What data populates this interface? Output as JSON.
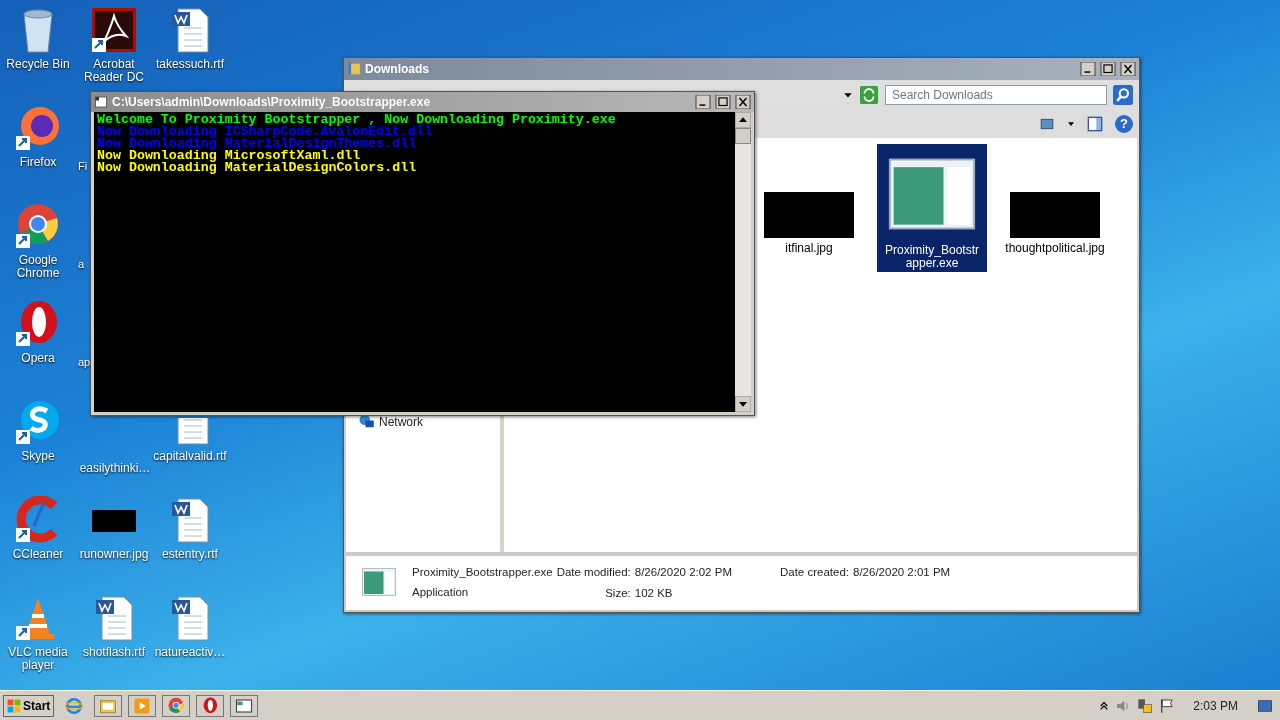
{
  "desktop_columns": [
    [
      {
        "label": "Recycle Bin",
        "kind": "recycle"
      },
      {
        "label": "Firefox",
        "kind": "firefox"
      },
      {
        "label": "Google Chrome",
        "kind": "chrome"
      },
      {
        "label": "Opera",
        "kind": "opera"
      },
      {
        "label": "Skype",
        "kind": "skype"
      },
      {
        "label": "CCleaner",
        "kind": "ccleaner"
      },
      {
        "label": "VLC media player",
        "kind": "vlc"
      }
    ],
    [
      {
        "label": "Acrobat Reader DC",
        "kind": "acrobat"
      },
      {
        "label": "Fi",
        "kind": "covered"
      },
      {
        "label": "a",
        "kind": "covered"
      },
      {
        "label": "ap",
        "kind": "covered"
      },
      {
        "label": "easilythinki…",
        "kind": "covered"
      },
      {
        "label": "runowner.jpg",
        "kind": "image"
      },
      {
        "label": "shotflash.rtf",
        "kind": "word"
      }
    ],
    [
      {
        "label": "takessuch.rtf",
        "kind": "word"
      },
      {
        "kind": "covered"
      },
      {
        "kind": "covered"
      },
      {
        "kind": "covered"
      },
      {
        "label": "capitalvalid.rtf",
        "kind": "word_partial"
      },
      {
        "label": "estentry.rtf",
        "kind": "word"
      },
      {
        "label": "natureactiv…",
        "kind": "word"
      }
    ]
  ],
  "explorer": {
    "title": "Downloads",
    "search": {
      "placeholder": "Search Downloads"
    },
    "nav_items": [
      {
        "label": "Network"
      }
    ],
    "help": "?",
    "files": [
      {
        "kind": "covered"
      },
      {
        "kind": "covered"
      },
      {
        "label": "itfinal.jpg",
        "kind": "image",
        "selected": false
      },
      {
        "label": "Proximity_Bootstrapper.exe",
        "kind": "app",
        "selected": true
      },
      {
        "label": "thoughtpolitical.jpg",
        "kind": "image",
        "selected": false
      }
    ],
    "details": {
      "name": "Proximity_Bootstrapper.exe",
      "type": "Application",
      "fields": [
        {
          "label": "Date modified:",
          "value": "8/26/2020 2:02 PM"
        },
        {
          "label": "Size:",
          "value": "102 KB"
        },
        {
          "label": "Date created:",
          "value": "8/26/2020 2:01 PM"
        }
      ]
    }
  },
  "console": {
    "title": "C:\\Users\\admin\\Downloads\\Proximity_Bootstrapper.exe",
    "lines": [
      {
        "text": "Welcome To Proximity Bootstrapper , Now Downloading Proximity.exe",
        "color": "#00ff00"
      },
      {
        "text": "Now Downloading ICSharpCode.AvalonEdit.dll",
        "color": "#0000ff"
      },
      {
        "text": "Now Downloading MaterialDesignThemes.dll",
        "color": "#0000ff"
      },
      {
        "text": "Now Downloading MicrosoftXaml.dll",
        "color": "#ffff00"
      },
      {
        "text": "Now Downloading MaterialDesignColors.dll",
        "color": "#ffff00"
      }
    ]
  },
  "taskbar": {
    "start": "Start",
    "apps": [
      {
        "kind": "ie"
      },
      {
        "kind": "folder"
      },
      {
        "kind": "media"
      },
      {
        "kind": "chrome"
      },
      {
        "kind": "opera"
      },
      {
        "kind": "console"
      }
    ],
    "clock": "2:03 PM"
  }
}
